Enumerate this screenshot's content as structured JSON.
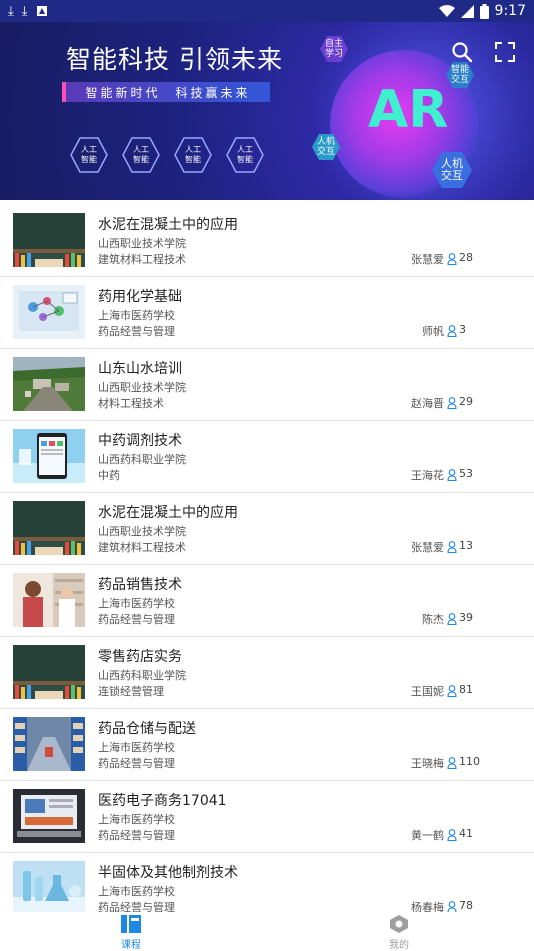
{
  "status_bar": {
    "time": "9:17",
    "left_icons": [
      "download-icon",
      "download-icon",
      "notification-icon"
    ],
    "right_icons": [
      "wifi-icon",
      "signal-icon",
      "battery-icon"
    ]
  },
  "banner": {
    "title": "智能科技 引领未来",
    "subtitle": "智能新时代　科技赢未来",
    "hex_tags": [
      "人工\n智能",
      "人工\n智能",
      "人工\n智能",
      "人工\n智能"
    ],
    "ar_label": "AR",
    "float_tags": [
      "自主\n学习",
      "智能\n交互",
      "人机\n交互",
      "人机\n交互"
    ],
    "slide_count": 4,
    "active_slide": 3
  },
  "courses": [
    {
      "title": "水泥在混凝土中的应用",
      "school": "山西职业技术学院",
      "major": "建筑材料工程技术",
      "teacher": "张慧爱",
      "count": "28",
      "thumb": "blackboard"
    },
    {
      "title": "药用化学基础",
      "school": "上海市医药学校",
      "major": "药品经营与管理",
      "teacher": "师帆",
      "count": "3",
      "thumb": "molecule"
    },
    {
      "title": "山东山水培训",
      "school": "山西职业技术学院",
      "major": "材料工程技术",
      "teacher": "赵海晋",
      "count": "29",
      "thumb": "aerial"
    },
    {
      "title": "中药调剂技术",
      "school": "山西药科职业学院",
      "major": "中药",
      "teacher": "王海花",
      "count": "53",
      "thumb": "phone"
    },
    {
      "title": "水泥在混凝土中的应用",
      "school": "山西职业技术学院",
      "major": "建筑材料工程技术",
      "teacher": "张慧爱",
      "count": "13",
      "thumb": "blackboard"
    },
    {
      "title": "药品销售技术",
      "school": "上海市医药学校",
      "major": "药品经营与管理",
      "teacher": "陈杰",
      "count": "39",
      "thumb": "pharmacy"
    },
    {
      "title": "零售药店实务",
      "school": "山西药科职业学院",
      "major": "连锁经营管理",
      "teacher": "王国妮",
      "count": "81",
      "thumb": "blackboard"
    },
    {
      "title": "药品仓储与配送",
      "school": "上海市医药学校",
      "major": "药品经营与管理",
      "teacher": "王晓梅",
      "count": "110",
      "thumb": "warehouse"
    },
    {
      "title": "医药电子商务17041",
      "school": "上海市医药学校",
      "major": "药品经营与管理",
      "teacher": "黄一鹤",
      "count": "41",
      "thumb": "computer"
    },
    {
      "title": "半固体及其他制剂技术",
      "school": "上海市医药学校",
      "major": "药品经营与管理",
      "teacher": "杨春梅",
      "count": "78",
      "thumb": "lab"
    }
  ],
  "tabs": [
    {
      "label": "课程",
      "icon": "course-icon",
      "active": true
    },
    {
      "label": "我的",
      "icon": "profile-icon",
      "active": false
    }
  ],
  "colors": {
    "accent": "#1e88e5",
    "inactive_tab": "#9e9e9e",
    "banner_bg": "#1d2380",
    "status_bar": "#1f2a86",
    "ar_text": "#3ff0d0"
  }
}
